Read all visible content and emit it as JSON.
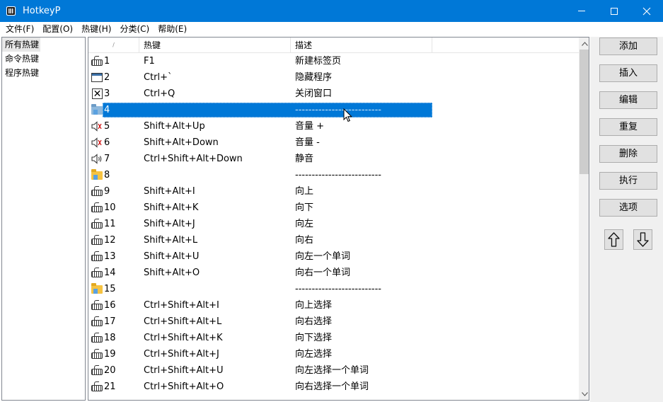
{
  "window": {
    "title": "HotkeyP",
    "controls": {
      "minimize": "minimize",
      "maximize": "maximize",
      "close": "close"
    }
  },
  "menu": [
    {
      "label": "文件(F)"
    },
    {
      "label": "配置(O)"
    },
    {
      "label": "热键(H)"
    },
    {
      "label": "分类(C)"
    },
    {
      "label": "帮助(E)"
    }
  ],
  "categories": [
    {
      "label": "所有热键",
      "selected": true
    },
    {
      "label": "命令热键",
      "selected": false
    },
    {
      "label": "程序热键",
      "selected": false
    }
  ],
  "list": {
    "columns": {
      "index": "/",
      "hotkey": "热键",
      "description": "描述"
    },
    "rows": [
      {
        "index": "1",
        "icon": "keyboard-icon",
        "hotkey": "F1",
        "desc": "新建标签页"
      },
      {
        "index": "2",
        "icon": "window-icon",
        "hotkey": "Ctrl+`",
        "desc": "隐藏程序"
      },
      {
        "index": "3",
        "icon": "close-window-icon",
        "hotkey": "Ctrl+Q",
        "desc": "关闭窗口"
      },
      {
        "index": "4",
        "icon": "folder-icon",
        "hotkey": "",
        "desc": "--------------------------",
        "selected": true
      },
      {
        "index": "5",
        "icon": "volume-up-icon",
        "hotkey": "Shift+Alt+Up",
        "desc": "音量 +"
      },
      {
        "index": "6",
        "icon": "volume-down-icon",
        "hotkey": "Shift+Alt+Down",
        "desc": "音量 -"
      },
      {
        "index": "7",
        "icon": "mute-icon",
        "hotkey": "Ctrl+Shift+Alt+Down",
        "desc": "静音"
      },
      {
        "index": "8",
        "icon": "folder-icon",
        "hotkey": "",
        "desc": "--------------------------"
      },
      {
        "index": "9",
        "icon": "keyboard-icon",
        "hotkey": "Shift+Alt+I",
        "desc": "向上"
      },
      {
        "index": "10",
        "icon": "keyboard-icon",
        "hotkey": "Shift+Alt+K",
        "desc": "向下"
      },
      {
        "index": "11",
        "icon": "keyboard-icon",
        "hotkey": "Shift+Alt+J",
        "desc": "向左"
      },
      {
        "index": "12",
        "icon": "keyboard-icon",
        "hotkey": "Shift+Alt+L",
        "desc": "向右"
      },
      {
        "index": "13",
        "icon": "keyboard-icon",
        "hotkey": "Shift+Alt+U",
        "desc": "向左一个单词"
      },
      {
        "index": "14",
        "icon": "keyboard-icon",
        "hotkey": "Shift+Alt+O",
        "desc": "向右一个单词"
      },
      {
        "index": "15",
        "icon": "folder-icon",
        "hotkey": "",
        "desc": "--------------------------"
      },
      {
        "index": "16",
        "icon": "keyboard-icon",
        "hotkey": "Ctrl+Shift+Alt+I",
        "desc": "向上选择"
      },
      {
        "index": "17",
        "icon": "keyboard-icon",
        "hotkey": "Ctrl+Shift+Alt+L",
        "desc": "向右选择"
      },
      {
        "index": "18",
        "icon": "keyboard-icon",
        "hotkey": "Ctrl+Shift+Alt+K",
        "desc": "向下选择"
      },
      {
        "index": "19",
        "icon": "keyboard-icon",
        "hotkey": "Ctrl+Shift+Alt+J",
        "desc": "向左选择"
      },
      {
        "index": "20",
        "icon": "keyboard-icon",
        "hotkey": "Ctrl+Shift+Alt+U",
        "desc": "向左选择一个单词"
      },
      {
        "index": "21",
        "icon": "keyboard-icon",
        "hotkey": "Ctrl+Shift+Alt+O",
        "desc": "向右选择一个单词"
      }
    ]
  },
  "buttons": {
    "add": "添加",
    "insert": "插入",
    "edit": "编辑",
    "repeat": "重复",
    "delete": "删除",
    "execute": "执行",
    "options": "选项",
    "move_up": "arrow-up-icon",
    "move_down": "arrow-down-icon"
  },
  "colors": {
    "titlebar": "#0078d7",
    "selection": "#0078d7",
    "button_face": "#e1e1e1",
    "panel": "#f0f0f0"
  }
}
